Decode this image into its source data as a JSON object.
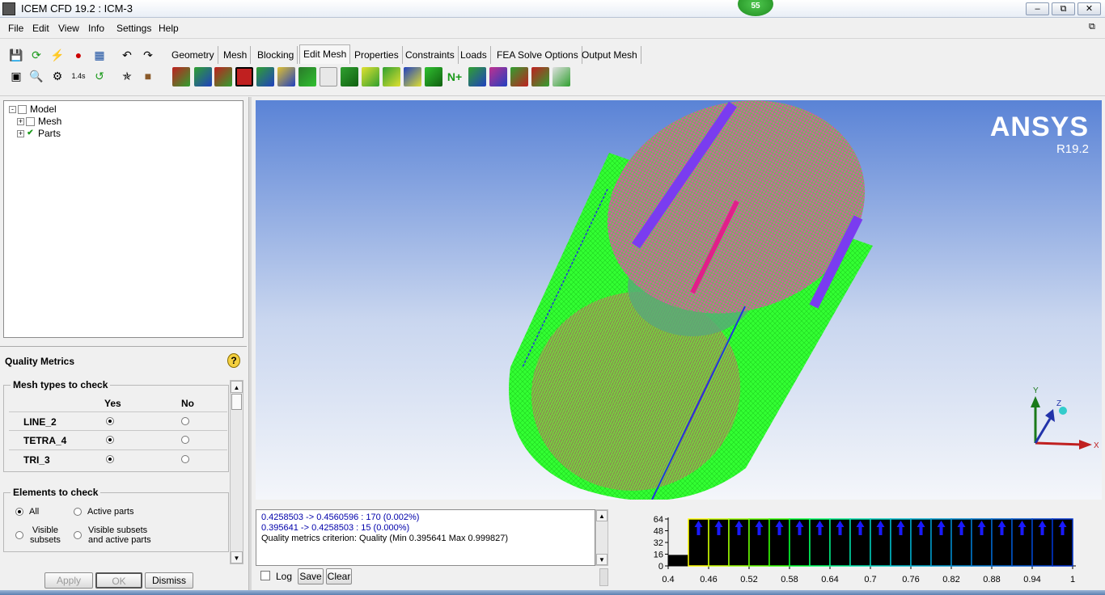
{
  "window": {
    "title": "ICEM CFD 19.2 : ICM-3",
    "badge": "55"
  },
  "menu": [
    "File",
    "Edit",
    "View",
    "Info",
    "Settings",
    "Help"
  ],
  "tabs": [
    "Geometry",
    "Mesh",
    "Blocking",
    "Edit Mesh",
    "Properties",
    "Constraints",
    "Loads",
    "FEA Solve Options",
    "Output Mesh"
  ],
  "active_tab": "Edit Mesh",
  "tree": {
    "root": "Model",
    "children": [
      "Mesh",
      "Parts"
    ]
  },
  "quality_metrics": {
    "title": "Quality Metrics",
    "mesh_types_legend": "Mesh types to check",
    "col_yes": "Yes",
    "col_no": "No",
    "mesh_types": [
      {
        "name": "LINE_2",
        "yes": true
      },
      {
        "name": "TETRA_4",
        "yes": true
      },
      {
        "name": "TRI_3",
        "yes": true
      }
    ],
    "elements_legend": "Elements to check",
    "opt_all": "All",
    "opt_active": "Active parts",
    "opt_visible_1": "Visible",
    "opt_visible_2": "subsets",
    "opt_vis_active_1": "Visible subsets",
    "opt_vis_active_2": "and active parts",
    "selected": "All"
  },
  "buttons": {
    "apply": "Apply",
    "ok": "OK",
    "dismiss": "Dismiss",
    "log": "Log",
    "save": "Save",
    "clear": "Clear"
  },
  "viewport": {
    "brand": "ANSYS",
    "version": "R19.2",
    "axis_x": "X",
    "axis_y": "Y",
    "axis_z": "Z",
    "mesh_colors": {
      "surface": "#33ff33",
      "cap": "#d65aa0",
      "edge": "#2233dd"
    }
  },
  "messages": [
    "0.4258503 -> 0.4560596 : 170 (0.002%)",
    "0.395641 -> 0.4258503 : 15 (0.000%)",
    "Quality metrics criterion: Quality (Min 0.395641 Max 0.999827)"
  ],
  "chart_data": {
    "type": "bar",
    "title": "",
    "xlabel": "",
    "ylabel": "",
    "y_ticks": [
      0,
      16,
      32,
      48,
      64
    ],
    "ylim": [
      0,
      64
    ],
    "x_ticks": [
      "0.4",
      "0.46",
      "0.52",
      "0.58",
      "0.64",
      "0.7",
      "0.76",
      "0.82",
      "0.88",
      "0.94",
      "1"
    ],
    "xlim": [
      0.4,
      1.0
    ],
    "bins": [
      {
        "from": 0.4,
        "to": 0.43,
        "value": 15
      },
      {
        "from": 0.43,
        "to": 1.0,
        "value": 64,
        "count": 19,
        "overflow": true
      }
    ],
    "bar_colors": [
      "#ffff00",
      "#ccff00",
      "#99ff00",
      "#66ff00",
      "#33ff00",
      "#00ff33",
      "#00ff66",
      "#00ee88",
      "#00ddaa",
      "#00ccbb",
      "#00bbcc",
      "#00aacc",
      "#0099cc",
      "#0088cc",
      "#0077cc",
      "#0066cc",
      "#0055cc",
      "#0044cc",
      "#0033cc"
    ]
  }
}
